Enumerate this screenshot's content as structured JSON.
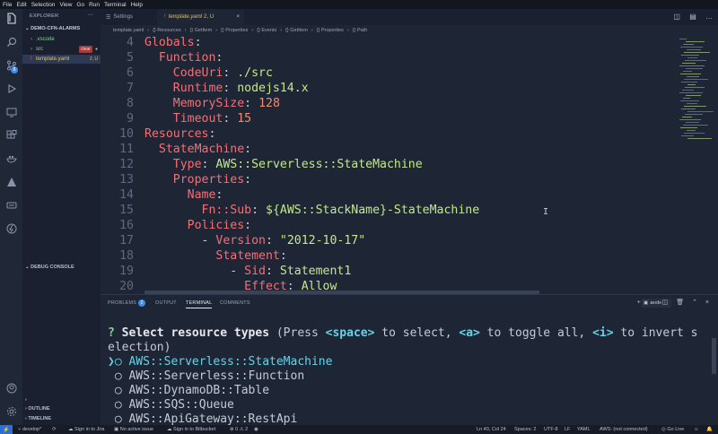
{
  "menu": [
    "File",
    "Edit",
    "Selection",
    "View",
    "Go",
    "Run",
    "Terminal",
    "Help"
  ],
  "activity": {
    "scm_badge": "8"
  },
  "sidebar": {
    "title": "EXPLORER",
    "more": "···",
    "folder": "DEMO-CFN-ALARMS",
    "items": [
      {
        "name": ".vscode",
        "chevron": "›",
        "tag": "clear",
        "color": "#7fd88f"
      },
      {
        "name": "src",
        "chevron": "›",
        "tag": "●",
        "color": "#7fd88f"
      },
      {
        "name": "template.yaml",
        "chevron": "!",
        "tag": "2, U",
        "color": "#e0c46c"
      }
    ],
    "debug_console": "DEBUG CONSOLE",
    "outline": "OUTLINE",
    "timeline": "TIMELINE"
  },
  "tabs": [
    {
      "label": "Settings"
    },
    {
      "label": "template.yaml",
      "modifier": "2, U",
      "close": "×"
    }
  ],
  "breadcrumbs": [
    "template.yaml",
    "{} Resources",
    "{} GetItem",
    "{} Properties",
    "{} Events",
    "{} GetItem",
    "{} Properties",
    "{} Path"
  ],
  "editor": {
    "lines": [
      {
        "num": "4",
        "indent": "",
        "key": "Globals",
        "sep": ":",
        "value": "",
        "vtype": "v"
      },
      {
        "num": "5",
        "indent": "  ",
        "key": "Function",
        "sep": ":",
        "value": "",
        "vtype": "v"
      },
      {
        "num": "6",
        "indent": "    ",
        "key": "CodeUri",
        "sep": ": ",
        "value": "./src",
        "vtype": "v"
      },
      {
        "num": "7",
        "indent": "    ",
        "key": "Runtime",
        "sep": ": ",
        "value": "nodejs14.x",
        "vtype": "v"
      },
      {
        "num": "8",
        "indent": "    ",
        "key": "MemorySize",
        "sep": ": ",
        "value": "128",
        "vtype": "n"
      },
      {
        "num": "9",
        "indent": "    ",
        "key": "Timeout",
        "sep": ": ",
        "value": "15",
        "vtype": "n"
      },
      {
        "num": "10",
        "indent": "",
        "key": "Resources",
        "sep": ":",
        "value": "",
        "vtype": "v"
      },
      {
        "num": "11",
        "indent": "  ",
        "key": "StateMachine",
        "sep": ":",
        "value": "",
        "vtype": "v"
      },
      {
        "num": "12",
        "indent": "    ",
        "key": "Type",
        "sep": ": ",
        "value": "AWS::Serverless::StateMachine",
        "vtype": "v"
      },
      {
        "num": "13",
        "indent": "    ",
        "key": "Properties",
        "sep": ":",
        "value": "",
        "vtype": "v"
      },
      {
        "num": "14",
        "indent": "      ",
        "key": "Name",
        "sep": ":",
        "value": "",
        "vtype": "v"
      },
      {
        "num": "15",
        "indent": "        ",
        "key": "Fn::Sub",
        "sep": ": ",
        "value": "${AWS::StackName}-StateMachine",
        "vtype": "v"
      },
      {
        "num": "16",
        "indent": "      ",
        "key": "Policies",
        "sep": ":",
        "value": "",
        "vtype": "v"
      },
      {
        "num": "17",
        "indent": "        - ",
        "key": "Version",
        "sep": ": ",
        "value": "\"2012-10-17\"",
        "vtype": "v"
      },
      {
        "num": "18",
        "indent": "          ",
        "key": "Statement",
        "sep": ":",
        "value": "",
        "vtype": "v"
      },
      {
        "num": "19",
        "indent": "            - ",
        "key": "Sid",
        "sep": ": ",
        "value": "Statement1",
        "vtype": "v"
      },
      {
        "num": "20",
        "indent": "              ",
        "key": "Effect",
        "sep": ": ",
        "value": "Allow",
        "vtype": "v"
      }
    ]
  },
  "panel": {
    "tabs": [
      "PROBLEMS",
      "OUTPUT",
      "TERMINAL",
      "COMMENTS"
    ],
    "problems_count": "2",
    "terminal_name": "node",
    "terminal": {
      "prompt_mark": "?",
      "prompt_bold": "Select resource types",
      "prompt_text_1": " (Press ",
      "key_space": "<space>",
      "prompt_text_2": " to select, ",
      "key_a": "<a>",
      "prompt_text_3": " to toggle all, ",
      "key_i": "<i>",
      "prompt_text_4": " to invert selection)",
      "options": [
        {
          "pointer": "❯",
          "marker": "○",
          "label": "AWS::Serverless::StateMachine",
          "selected": true
        },
        {
          "pointer": " ",
          "marker": "○",
          "label": "AWS::Serverless::Function",
          "selected": false
        },
        {
          "pointer": " ",
          "marker": "○",
          "label": "AWS::DynamoDB::Table",
          "selected": false
        },
        {
          "pointer": " ",
          "marker": "○",
          "label": "AWS::SQS::Queue",
          "selected": false
        },
        {
          "pointer": " ",
          "marker": "○",
          "label": "AWS::ApiGateway::RestApi",
          "selected": false
        }
      ]
    }
  },
  "status": {
    "branch": "develop*",
    "jira": "Sign in to Jira",
    "issue": "No active issue",
    "bitbucket": "Sign in to Bitbucket",
    "problems": "⊗ 0 ⚠ 2",
    "position": "Ln 40, Col 24",
    "spaces": "Spaces: 2",
    "encoding": "UTF-8",
    "eol": "LF",
    "language": "YAML",
    "aws": "AWS: (not connected)",
    "golive": "Go Live"
  }
}
